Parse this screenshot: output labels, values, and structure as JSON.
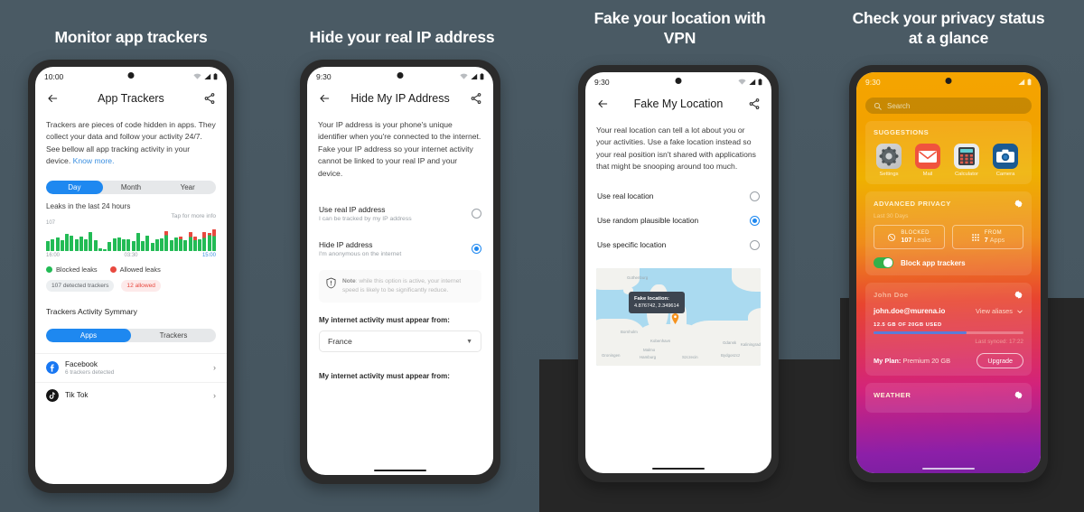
{
  "headlines": [
    "Monitor app trackers",
    "Hide your real IP address",
    "Fake your location with VPN",
    "Check your privacy status at a glance"
  ],
  "colors": {
    "background": "#47575f",
    "accent_blue": "#1e88f0",
    "blocked_green": "#22bb55",
    "allowed_red": "#e8493f",
    "link_blue": "#3a8fe0",
    "toggle_green": "#34b04a",
    "dark_band": "#262626"
  },
  "phone1": {
    "status": {
      "time": "10:00",
      "wifi_icon": "wifi-icon",
      "signal_icon": "signal-icon",
      "battery_icon": "battery-icon"
    },
    "appbar": {
      "back_icon": "back-arrow-icon",
      "title": "App Trackers",
      "share_icon": "share-icon"
    },
    "description": "Trackers are pieces of code hidden in apps. They collect your data and follow your activity 24/7. See bellow all app tracking activity in your device.",
    "link": "Know more.",
    "segments": [
      "Day",
      "Month",
      "Year"
    ],
    "segment_active": "Day",
    "leaks_label": "Leaks in the last 24 hours",
    "tap_info": "Tap for more info",
    "legend": [
      {
        "label": "Blocked leaks",
        "color": "#22bb55"
      },
      {
        "label": "Allowed leaks",
        "color": "#e8493f"
      }
    ],
    "chips": [
      {
        "label": "107 detected trackers",
        "style": "grey"
      },
      {
        "label": "12 allowed",
        "style": "red"
      }
    ],
    "summary_title": "Trackers Activity Symmary",
    "summary_segments": [
      "Apps",
      "Trackers"
    ],
    "summary_active": "Apps",
    "apps": [
      {
        "name": "Facebook",
        "sub": "6 trackers detected",
        "icon": "facebook-icon",
        "chevron": "chevron-right-icon"
      },
      {
        "name": "Tik Tok",
        "sub": "",
        "icon": "tiktok-icon",
        "chevron": "chevron-right-icon"
      }
    ]
  },
  "phone2": {
    "status": {
      "time": "9:30"
    },
    "appbar": {
      "title": "Hide My IP Address"
    },
    "description": "Your IP address is your phone's unique identifier when you're connected to the internet. Fake your IP address so your internet activity cannot be linked to your real IP and your device.",
    "options": [
      {
        "label": "Use real IP address",
        "sub": "I can be tracked by my IP address",
        "selected": false
      },
      {
        "label": "Hide IP address",
        "sub": "I'm anonymous on the internet",
        "selected": true
      }
    ],
    "note_prefix": "Note",
    "note_text": ": while this option is active, your internet speed is likely to be significantly reduce.",
    "note_icon": "shield-warning-icon",
    "field_label_1": "My internet activity must appear from:",
    "select_value": "France",
    "field_label_2": "My internet activity must appear from:"
  },
  "phone3": {
    "status": {
      "time": "9:30"
    },
    "appbar": {
      "title": "Fake My Location"
    },
    "description": "Your real location can tell a lot about you or your activities. Use a fake location instead so your real position isn't shared with applications that might be snooping around too much.",
    "options": [
      {
        "label": "Use real location",
        "selected": false
      },
      {
        "label": "Use random plausible location",
        "selected": true
      },
      {
        "label": "Use specific location",
        "selected": false
      }
    ],
    "map": {
      "tooltip_title": "Fake location:",
      "tooltip_coords": "4.876742, 2.349614",
      "pin_icon": "map-pin-icon",
      "labels": [
        "Gothenburg",
        "Bornholm",
        "Kobenhavn",
        "Malmo",
        "Gdansk",
        "Hamburg",
        "Szczecin",
        "Bydgoszcz",
        "Groningen",
        "Kaliningrad"
      ]
    }
  },
  "phone4": {
    "status": {
      "time": "9:30"
    },
    "search": {
      "placeholder": "Search",
      "icon": "search-icon"
    },
    "suggestions": {
      "title": "SUGGESTIONS",
      "apps": [
        {
          "label": "Settings",
          "icon": "settings-icon"
        },
        {
          "label": "Mail",
          "icon": "mail-icon"
        },
        {
          "label": "Calculator",
          "icon": "calculator-icon"
        },
        {
          "label": "Camera",
          "icon": "camera-icon"
        }
      ]
    },
    "advanced_privacy": {
      "title": "ADVANCED PRIVACY",
      "gear_icon": "gear-icon",
      "period": "Last 30 Days",
      "stats": [
        {
          "key": "BLOCKED",
          "value": "107",
          "unit": "Leaks",
          "icon": "block-icon"
        },
        {
          "key": "FROM",
          "value": "7",
          "unit": "Apps",
          "icon": "grid-icon"
        }
      ],
      "toggle_label": "Block app trackers",
      "toggle_on": true
    },
    "account": {
      "name": "John Doe",
      "gear_icon": "gear-icon",
      "email": "john.doe@murena.io",
      "aliases_label": "View aliases",
      "aliases_icon": "chevron-down-icon",
      "usage_text": "12.5 GB OF 20GB USED",
      "usage_percent": 62,
      "synced": "Last synced: 17:22",
      "plan_label": "My Plan:",
      "plan_value": "Premium 20 GB",
      "upgrade_label": "Upgrade"
    },
    "weather": {
      "title": "WEATHER",
      "gear_icon": "gear-icon"
    }
  },
  "chart_data": {
    "type": "bar",
    "title": "Leaks in the last 24 hours",
    "xlabel": "",
    "ylabel": "",
    "ylim": [
      0,
      107
    ],
    "ymax_label": "107",
    "tick_labels": [
      "16:00",
      "03:30",
      "15:00"
    ],
    "grid": false,
    "legend_position": "below",
    "series": [
      {
        "name": "Blocked leaks",
        "color": "#22bb55",
        "values": [
          44,
          52,
          60,
          46,
          78,
          70,
          52,
          66,
          52,
          84,
          46,
          12,
          8,
          40,
          56,
          62,
          50,
          54,
          44,
          80,
          42,
          70,
          34,
          52,
          58,
          70,
          46,
          60,
          52,
          46,
          62,
          48,
          54,
          60,
          70,
          66
        ]
      },
      {
        "name": "Allowed leaks",
        "color": "#e8493f",
        "values": [
          0,
          0,
          0,
          0,
          0,
          0,
          0,
          0,
          0,
          0,
          0,
          0,
          0,
          0,
          0,
          0,
          0,
          0,
          0,
          0,
          0,
          0,
          0,
          0,
          0,
          18,
          0,
          0,
          12,
          0,
          22,
          16,
          0,
          26,
          10,
          30
        ]
      }
    ]
  }
}
